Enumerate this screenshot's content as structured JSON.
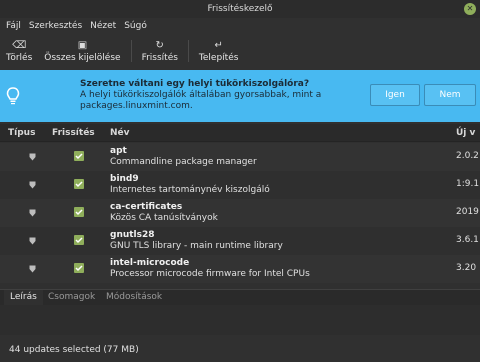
{
  "window": {
    "title": "Frissítéskezelő"
  },
  "menu": [
    "Fájl",
    "Szerkesztés",
    "Nézet",
    "Súgó"
  ],
  "toolbar": {
    "clear": "Törlés",
    "select_all": "Összes kijelölése",
    "refresh": "Frissítés",
    "install": "Telepítés"
  },
  "banner": {
    "title": "Szeretne váltani egy helyi tükörkiszolgálóra?",
    "text": "A helyi tükörkiszolgálók általában gyorsabbak, mint a packages.linuxmint.com.",
    "yes": "Igen",
    "no": "Nem",
    "color": "#48b9f1"
  },
  "table": {
    "headers": {
      "type": "Típus",
      "update": "Frissítés",
      "name": "Név",
      "version": "Új v"
    },
    "rows": [
      {
        "name": "apt",
        "desc": "Commandline package manager",
        "version": "2.0.2",
        "checked": true,
        "type_icon": "shield-icon"
      },
      {
        "name": "bind9",
        "desc": "Internetes tartománynév kiszolgáló",
        "version": "1:9.1",
        "checked": true,
        "type_icon": "shield-icon"
      },
      {
        "name": "ca-certificates",
        "desc": "Közös CA tanúsítványok",
        "version": "2019",
        "checked": true,
        "type_icon": "shield-icon"
      },
      {
        "name": "gnutls28",
        "desc": "GNU TLS library - main runtime library",
        "version": "3.6.1",
        "checked": true,
        "type_icon": "shield-icon"
      },
      {
        "name": "intel-microcode",
        "desc": "Processor microcode firmware for Intel CPUs",
        "version": "3.20",
        "checked": true,
        "type_icon": "shield-icon"
      }
    ]
  },
  "tabs": [
    "Leírás",
    "Csomagok",
    "Módosítások"
  ],
  "status": "44 updates selected (77 MB)",
  "colors": {
    "accent": "#8fae5b"
  }
}
